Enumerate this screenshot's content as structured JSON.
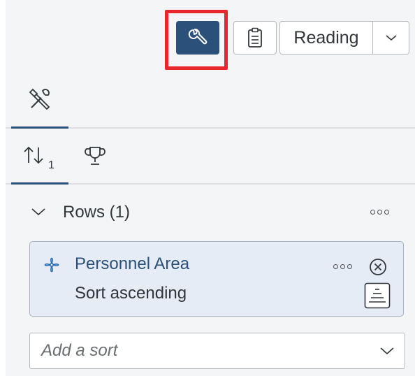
{
  "toolbar": {
    "tools_button_icon": "wrench-icon",
    "clipboard_button_icon": "clipboard-icon",
    "view_mode": {
      "selected": "Reading",
      "dropdown_icon": "chevron-down-icon"
    },
    "highlight_color": "#e8262d",
    "accent_color": "#2b5079"
  },
  "tabs_primary": [
    {
      "icon": "tools-icon",
      "active": true
    }
  ],
  "tabs_secondary": [
    {
      "icon": "sort-icon",
      "active": true
    },
    {
      "icon": "trophy-icon",
      "active": false
    }
  ],
  "rows_section": {
    "title": "Rows (1)",
    "expand_icon": "chevron-down-icon",
    "more_icon": "more-icon",
    "items": [
      {
        "name": "Personnel Area",
        "sort": "Sort ascending",
        "icon": "dimension-icon",
        "more_icon": "more-icon",
        "remove_icon": "remove-icon",
        "sort_order_icon": "sort-order-icon"
      }
    ],
    "add_sort": {
      "placeholder": "Add a sort",
      "dropdown_icon": "chevron-down-icon"
    }
  }
}
